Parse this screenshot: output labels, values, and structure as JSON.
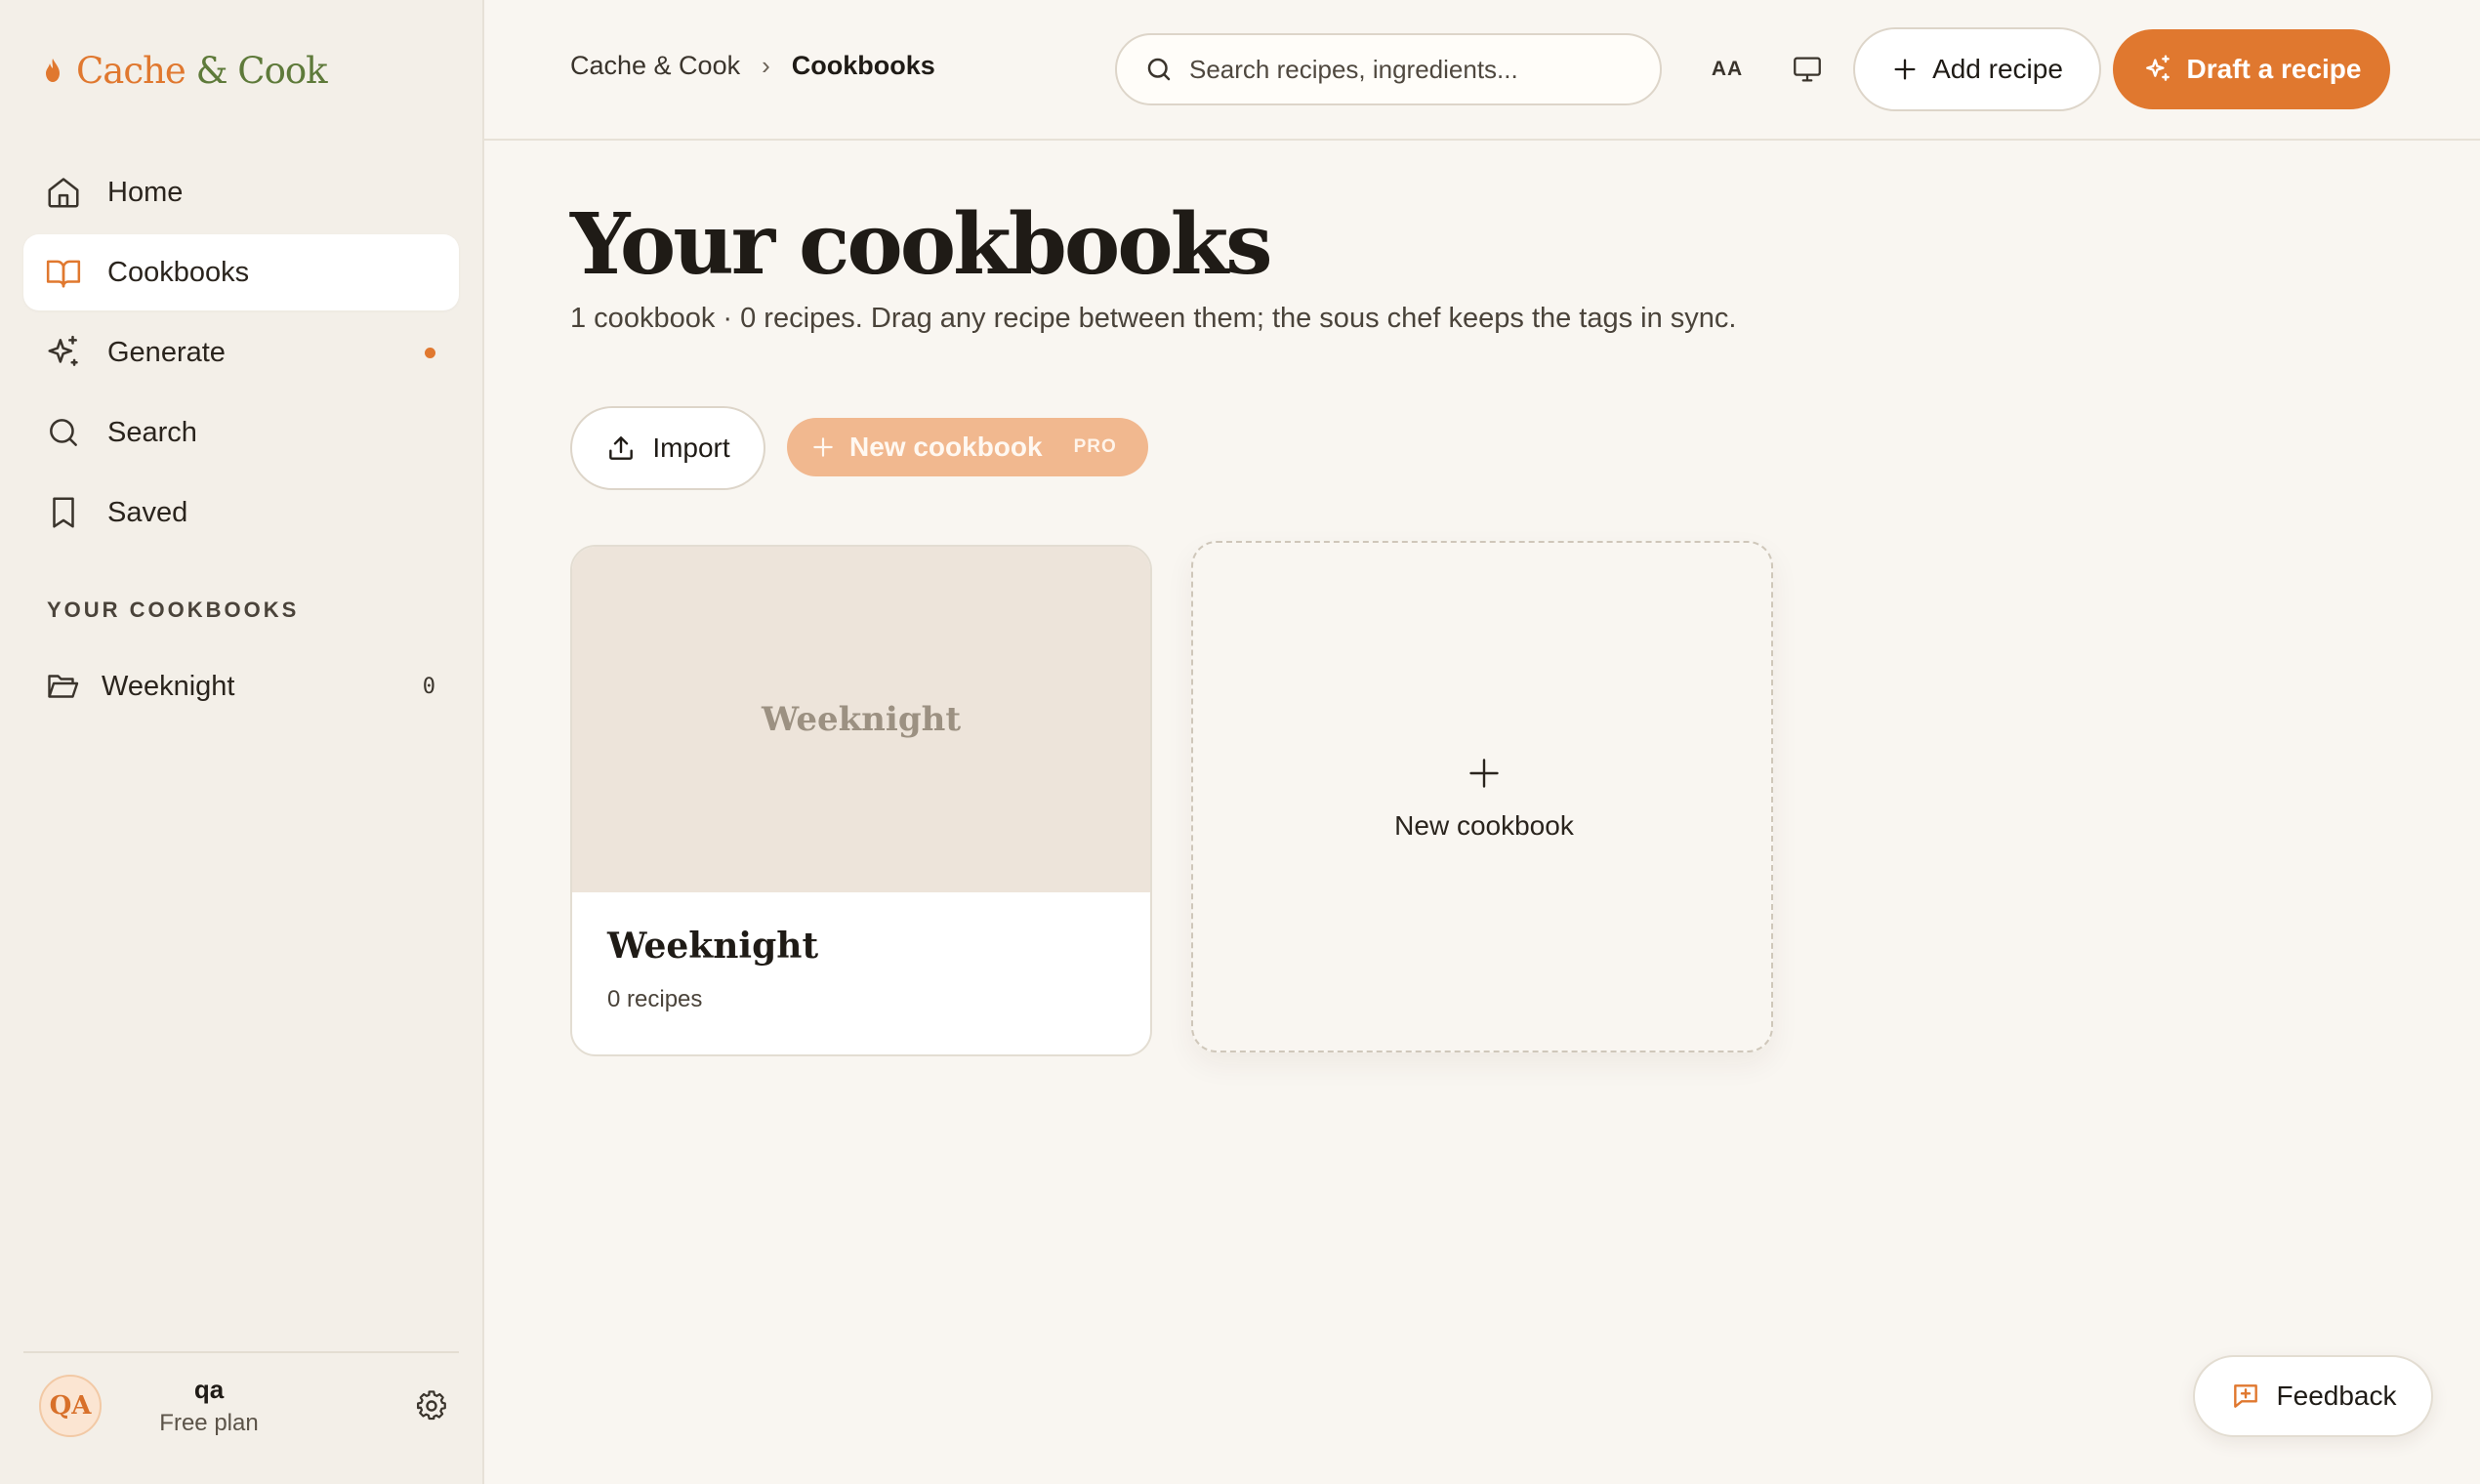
{
  "brand": {
    "part1": "Cache",
    "amp": "&",
    "part2": "Cook"
  },
  "sidebar": {
    "items": [
      {
        "label": "Home",
        "icon": "home-icon"
      },
      {
        "label": "Cookbooks",
        "icon": "book-open-icon",
        "active": true
      },
      {
        "label": "Generate",
        "icon": "sparkles-icon",
        "has_dot": true
      },
      {
        "label": "Search",
        "icon": "search-icon"
      },
      {
        "label": "Saved",
        "icon": "bookmark-icon"
      }
    ],
    "section_label": "YOUR COOKBOOKS",
    "cookbooks": [
      {
        "label": "Weeknight",
        "count": "0",
        "icon": "folder-open-icon"
      }
    ],
    "profile": {
      "initials": "QA",
      "name": "qa",
      "plan": "Free plan"
    }
  },
  "header": {
    "breadcrumb": {
      "root": "Cache & Cook",
      "separator": "›",
      "current": "Cookbooks"
    },
    "search_placeholder": "Search recipes, ingredients...",
    "text_size_label": "AA",
    "add_recipe_label": "Add recipe",
    "draft_recipe_label": "Draft a recipe"
  },
  "main": {
    "title": "Your cookbooks",
    "subtitle": "1 cookbook · 0 recipes. Drag any recipe between them; the sous chef keeps the tags in sync.",
    "import_label": "Import",
    "new_cookbook_label": "New cookbook",
    "pro_badge": "PRO",
    "cards": [
      {
        "cover_text": "Weeknight",
        "title": "Weeknight",
        "subtitle": "0 recipes"
      }
    ],
    "new_card_label": "New cookbook"
  },
  "feedback_label": "Feedback",
  "colors": {
    "accent": "#e0782f",
    "accent_light": "#f1b88f",
    "brand_green": "#5e7a3a",
    "background": "#f9f6f1",
    "sidebar_bg": "#f3efe8"
  }
}
